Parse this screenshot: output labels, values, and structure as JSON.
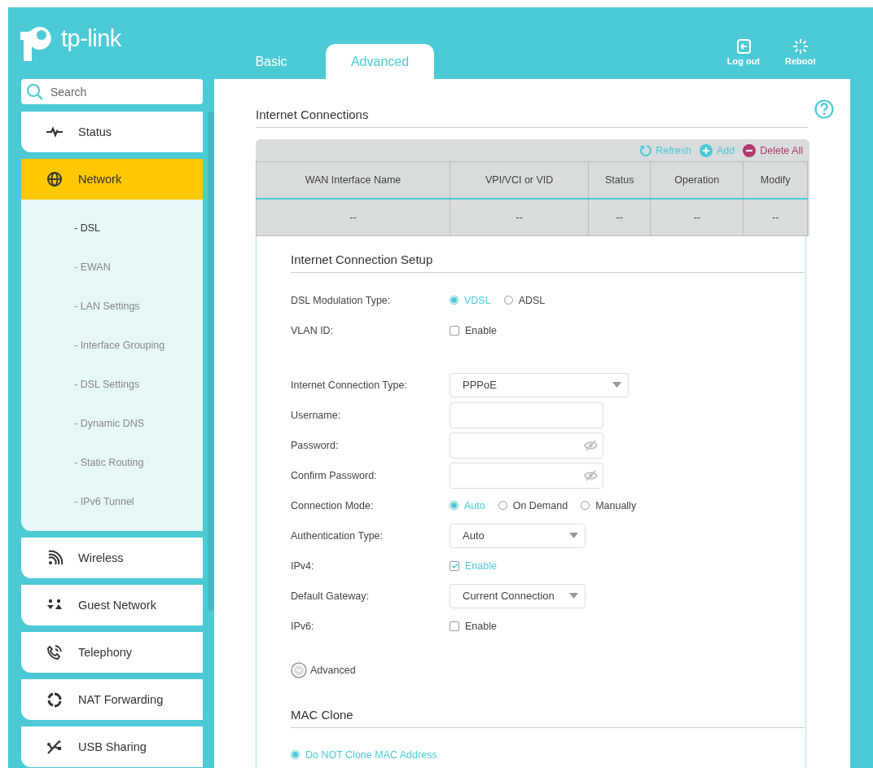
{
  "logo": {
    "text": "tp-link"
  },
  "tabs": [
    {
      "label": "Basic",
      "selected": false
    },
    {
      "label": "Advanced",
      "selected": true
    }
  ],
  "header_actions": [
    {
      "label": "Log out",
      "kind": "logout"
    },
    {
      "label": "Reboot",
      "kind": "reboot"
    }
  ],
  "sidebar": {
    "search": {
      "placeholder": "Search"
    },
    "items": [
      {
        "label": "Status",
        "selected": false
      },
      {
        "label": "Network",
        "selected": true,
        "expanded": true,
        "children": [
          {
            "label": "- DSL",
            "selected": true
          },
          {
            "label": "- EWAN",
            "selected": false
          },
          {
            "label": "- LAN Settings",
            "selected": false
          },
          {
            "label": "- Interface Grouping",
            "selected": false
          },
          {
            "label": "- DSL Settings",
            "selected": false
          },
          {
            "label": "- Dynamic DNS",
            "selected": false
          },
          {
            "label": "- Static Routing",
            "selected": false
          },
          {
            "label": "- IPv6 Tunnel",
            "selected": false
          }
        ]
      },
      {
        "label": "Wireless",
        "selected": false
      },
      {
        "label": "Guest Network",
        "selected": false
      },
      {
        "label": "Telephony",
        "selected": false
      },
      {
        "label": "NAT Forwarding",
        "selected": false
      },
      {
        "label": "USB Sharing",
        "selected": false
      }
    ]
  },
  "internet_connections": {
    "title": "Internet Connections",
    "toolbar": [
      {
        "label": "Refresh",
        "kind": "refresh"
      },
      {
        "label": "Add",
        "kind": "add"
      },
      {
        "label": "Delete All",
        "kind": "delete"
      }
    ],
    "table": {
      "columns": [
        "WAN Interface Name",
        "VPI/VCI or VID",
        "Status",
        "Operation",
        "Modify"
      ],
      "rows": [
        [
          "--",
          "--",
          "--",
          "--",
          "--"
        ]
      ]
    }
  },
  "setup": {
    "title": "Internet Connection Setup",
    "field_groups": [
      [
        {
          "label": "DSL Modulation Type:",
          "kind": "radio",
          "options": [
            {
              "label": "VDSL",
              "selected": true
            },
            {
              "label": "ADSL",
              "selected": false
            }
          ]
        },
        {
          "label": "VLAN ID:",
          "kind": "checkbox",
          "option": "Enable",
          "checked": false
        }
      ],
      [
        {
          "label": "Internet Connection Type:",
          "kind": "select",
          "value": "PPPoE"
        },
        {
          "label": "Username:",
          "kind": "text"
        },
        {
          "label": "Password:",
          "kind": "password"
        },
        {
          "label": "Confirm Password:",
          "kind": "password"
        },
        {
          "label": "Connection Mode:",
          "kind": "radio",
          "options": [
            {
              "label": "Auto",
              "selected": true
            },
            {
              "label": "On Demand",
              "selected": false
            },
            {
              "label": "Manually",
              "selected": false
            }
          ]
        },
        {
          "label": "Authentication Type:",
          "kind": "select",
          "value": "Auto"
        },
        {
          "label": "IPv4:",
          "kind": "checkbox",
          "option": "Enable",
          "checked": true
        },
        {
          "label": "Default Gateway:",
          "kind": "select",
          "value": "Current Connection"
        },
        {
          "label": "IPv6:",
          "kind": "checkbox",
          "option": "Enable",
          "checked": false
        }
      ]
    ],
    "advanced_toggle": {
      "label": "Advanced",
      "expanded": false
    }
  },
  "mac_clone": {
    "title": "MAC Clone",
    "options": [
      {
        "label": "Do NOT Clone MAC Address",
        "selected": true
      }
    ]
  }
}
